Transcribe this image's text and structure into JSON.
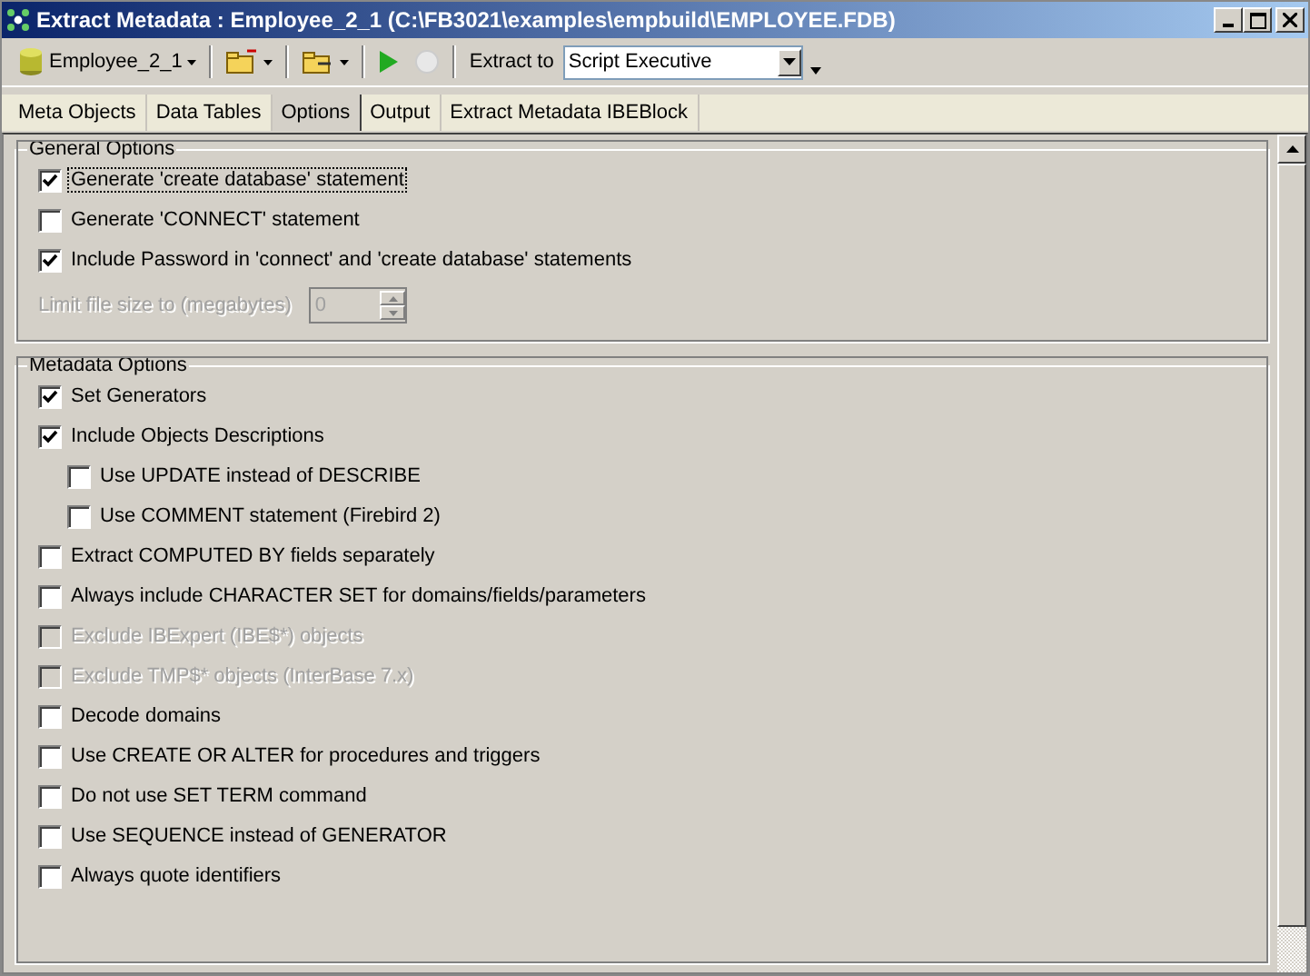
{
  "window": {
    "title": "Extract Metadata : Employee_2_1 (C:\\FB3021\\examples\\empbuild\\EMPLOYEE.FDB)"
  },
  "toolbar": {
    "database": "Employee_2_1",
    "run_disabled": false,
    "stop_disabled": true,
    "extract_label": "Extract to",
    "extract_target": "Script Executive"
  },
  "tabs": [
    {
      "label": "Meta Objects",
      "selected": false
    },
    {
      "label": "Data Tables",
      "selected": false
    },
    {
      "label": "Options",
      "selected": true
    },
    {
      "label": "Output",
      "selected": false
    },
    {
      "label": "Extract Metadata IBEBlock",
      "selected": false
    }
  ],
  "general_options": {
    "title": "General Options",
    "options": [
      {
        "label": "Generate 'create database' statement",
        "checked": true,
        "disabled": false,
        "focused": true
      },
      {
        "label": "Generate 'CONNECT' statement",
        "checked": false,
        "disabled": false,
        "focused": false
      },
      {
        "label": "Include Password in 'connect' and 'create database' statements",
        "checked": true,
        "disabled": false,
        "focused": false
      }
    ],
    "limit": {
      "label": "Limit file size to (megabytes)",
      "value": "0",
      "disabled": true
    }
  },
  "metadata_options": {
    "title": "Metadata Options",
    "options": [
      {
        "label": "Set Generators",
        "checked": true,
        "disabled": false
      },
      {
        "label": "Include Objects Descriptions",
        "checked": true,
        "disabled": false,
        "children": [
          {
            "label": "Use UPDATE instead of DESCRIBE",
            "checked": false,
            "disabled": false
          },
          {
            "label": "Use COMMENT statement (Firebird 2)",
            "checked": false,
            "disabled": false
          }
        ]
      },
      {
        "label": "Extract COMPUTED BY fields separately",
        "checked": false,
        "disabled": false
      },
      {
        "label": "Always include CHARACTER SET for domains/fields/parameters",
        "checked": false,
        "disabled": false
      },
      {
        "label": "Exclude IBExpert (IBE$*) objects",
        "checked": false,
        "disabled": true
      },
      {
        "label": "Exclude TMP$* objects (InterBase 7.x)",
        "checked": false,
        "disabled": true
      },
      {
        "label": "Decode domains",
        "checked": false,
        "disabled": false
      },
      {
        "label": "Use CREATE OR ALTER for procedures and triggers",
        "checked": false,
        "disabled": false
      },
      {
        "label": "Do not use SET TERM command",
        "checked": false,
        "disabled": false
      },
      {
        "label": "Use SEQUENCE instead of GENERATOR",
        "checked": false,
        "disabled": false
      },
      {
        "label": "Always quote identifiers",
        "checked": false,
        "disabled": false
      }
    ]
  }
}
